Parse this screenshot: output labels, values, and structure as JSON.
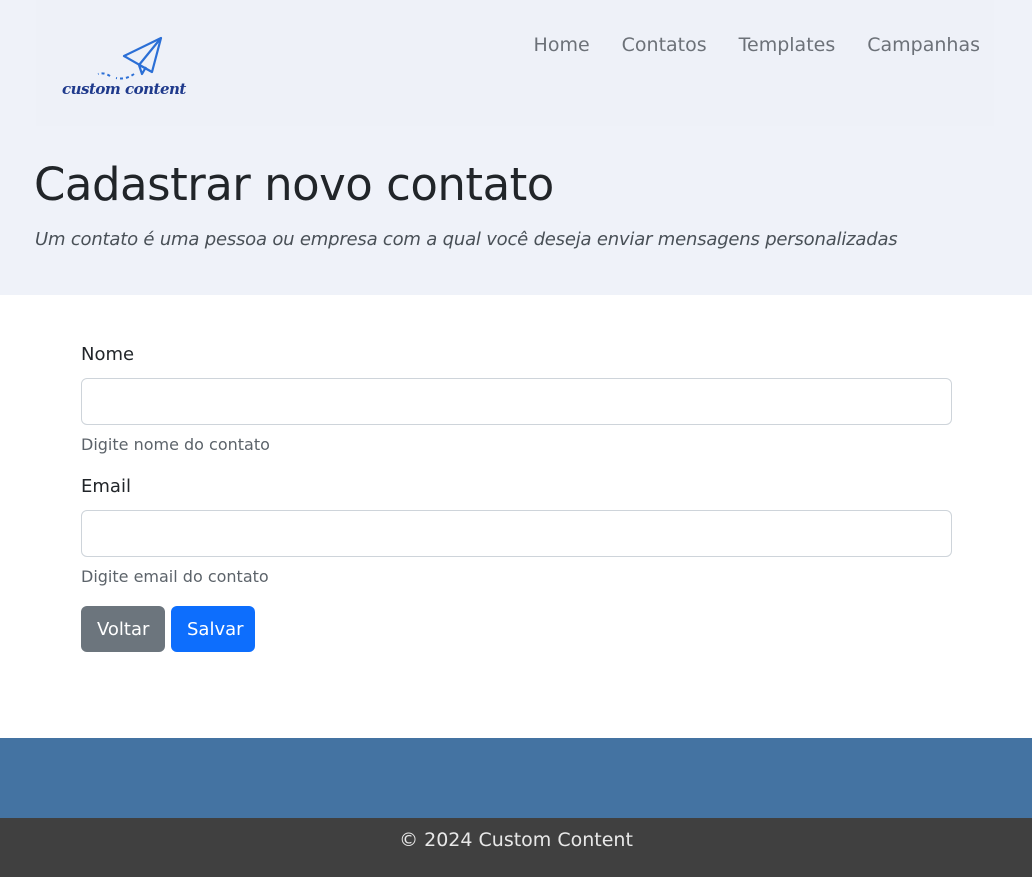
{
  "brand": {
    "logo_text": "custom content",
    "logo_icon": "paper-plane-icon",
    "color": "#2b6fd6"
  },
  "nav": {
    "items": [
      {
        "label": "Home"
      },
      {
        "label": "Contatos"
      },
      {
        "label": "Templates"
      },
      {
        "label": "Campanhas"
      }
    ]
  },
  "header": {
    "title": "Cadastrar novo contato",
    "subtitle": "Um contato é uma pessoa ou empresa com a qual você deseja enviar mensagens personalizadas"
  },
  "form": {
    "name": {
      "label": "Nome",
      "value": "",
      "help": "Digite nome do contato"
    },
    "email": {
      "label": "Email",
      "value": "",
      "help": "Digite email do contato"
    },
    "back_label": "Voltar",
    "save_label": "Salvar"
  },
  "footer": {
    "text": "© 2024 Custom Content"
  },
  "colors": {
    "header_bg": "#eff2f9",
    "primary": "#0d6efd",
    "secondary": "#6c757d",
    "footer_band": "#4473a2",
    "footer_bar": "#404040"
  }
}
